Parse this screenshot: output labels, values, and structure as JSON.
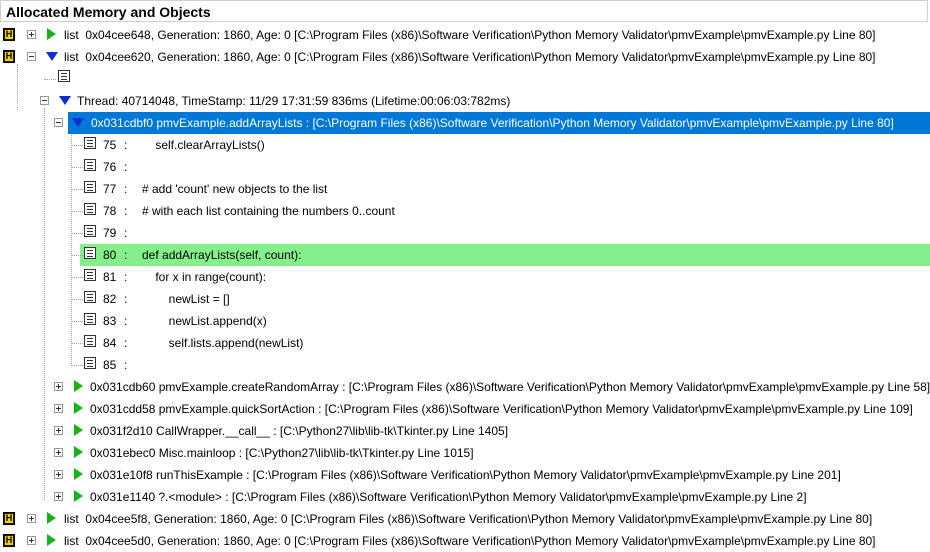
{
  "header": {
    "title": "Allocated Memory and Objects"
  },
  "rows": [
    {
      "text": "list  0x04cee648, Generation: 1860, Age: 0 [C:\\Program Files (x86)\\Software Verification\\Python Memory Validator\\pmvExample\\pmvExample.py Line 80]"
    },
    {
      "text": "list  0x04cee620, Generation: 1860, Age: 0 [C:\\Program Files (x86)\\Software Verification\\Python Memory Validator\\pmvExample\\pmvExample.py Line 80]"
    },
    {
      "text": ""
    },
    {
      "text": "Thread: 40714048, TimeStamp: 11/29 17:31:59 836ms (Lifetime:00:06:03:782ms)"
    },
    {
      "text": "0x031cdbf0 pmvExample.addArrayLists : [C:\\Program Files (x86)\\Software Verification\\Python Memory Validator\\pmvExample\\pmvExample.py Line 80]"
    },
    {
      "num": "75",
      "code": "    self.clearArrayLists()"
    },
    {
      "num": "76",
      "code": ""
    },
    {
      "num": "77",
      "code": "# add 'count' new objects to the list"
    },
    {
      "num": "78",
      "code": "# with each list containing the numbers 0..count"
    },
    {
      "num": "79",
      "code": ""
    },
    {
      "num": "80",
      "code": "def addArrayLists(self, count):"
    },
    {
      "num": "81",
      "code": "    for x in range(count):"
    },
    {
      "num": "82",
      "code": "        newList = []"
    },
    {
      "num": "83",
      "code": "        newList.append(x)"
    },
    {
      "num": "84",
      "code": "        self.lists.append(newList)"
    },
    {
      "num": "85",
      "code": ""
    },
    {
      "text": "0x031cdb60 pmvExample.createRandomArray : [C:\\Program Files (x86)\\Software Verification\\Python Memory Validator\\pmvExample\\pmvExample.py Line 58]"
    },
    {
      "text": "0x031cdd58 pmvExample.quickSortAction : [C:\\Program Files (x86)\\Software Verification\\Python Memory Validator\\pmvExample\\pmvExample.py Line 109]"
    },
    {
      "text": "0x031f2d10 CallWrapper.__call__ : [C:\\Python27\\lib\\lib-tk\\Tkinter.py Line 1405]"
    },
    {
      "text": "0x031ebec0 Misc.mainloop : [C:\\Python27\\lib\\lib-tk\\Tkinter.py Line 1015]"
    },
    {
      "text": "0x031e10f8 runThisExample : [C:\\Program Files (x86)\\Software Verification\\Python Memory Validator\\pmvExample\\pmvExample.py Line 201]"
    },
    {
      "text": "0x031e1140 ?.<module> : [C:\\Program Files (x86)\\Software Verification\\Python Memory Validator\\pmvExample\\pmvExample.py Line 2]"
    },
    {
      "text": "list  0x04cee5f8, Generation: 1860, Age: 0 [C:\\Program Files (x86)\\Software Verification\\Python Memory Validator\\pmvExample\\pmvExample.py Line 80]"
    },
    {
      "text": "list  0x04cee5d0, Generation: 1860, Age: 0 [C:\\Program Files (x86)\\Software Verification\\Python Memory Validator\\pmvExample\\pmvExample.py Line 80]"
    }
  ],
  "colors": {
    "selected": "#0078d7",
    "highlight": "#85f08a",
    "heap_icon": "#f4d000"
  }
}
